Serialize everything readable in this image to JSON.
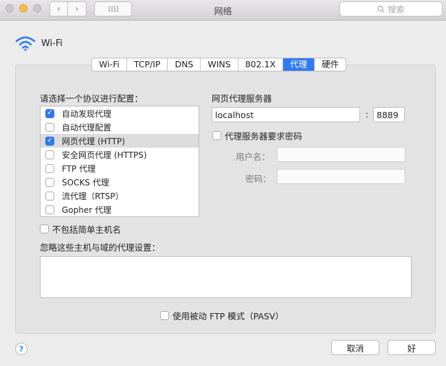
{
  "window": {
    "title": "网络",
    "search_placeholder": "搜索"
  },
  "header": {
    "service_name": "Wi-Fi"
  },
  "tabs": [
    {
      "label": "Wi-Fi",
      "active": false
    },
    {
      "label": "TCP/IP",
      "active": false
    },
    {
      "label": "DNS",
      "active": false
    },
    {
      "label": "WINS",
      "active": false
    },
    {
      "label": "802.1X",
      "active": false
    },
    {
      "label": "代理",
      "active": true
    },
    {
      "label": "硬件",
      "active": false
    }
  ],
  "protocols": {
    "heading": "请选择一个协议进行配置：",
    "items": [
      {
        "label": "自动发现代理",
        "checked": true,
        "selected": false
      },
      {
        "label": "自动代理配置",
        "checked": false,
        "selected": false
      },
      {
        "label": "网页代理 (HTTP)",
        "checked": true,
        "selected": true
      },
      {
        "label": "安全网页代理 (HTTPS)",
        "checked": false,
        "selected": false
      },
      {
        "label": "FTP 代理",
        "checked": false,
        "selected": false
      },
      {
        "label": "SOCKS 代理",
        "checked": false,
        "selected": false
      },
      {
        "label": "流代理（RTSP）",
        "checked": false,
        "selected": false
      },
      {
        "label": "Gopher 代理",
        "checked": false,
        "selected": false
      }
    ]
  },
  "proxy_server": {
    "heading": "网页代理服务器",
    "host": "localhost",
    "separator": ":",
    "port": "8889",
    "requires_password_label": "代理服务器要求密码",
    "requires_password": false,
    "username_label": "用户名：",
    "username": "",
    "password_label": "密码：",
    "password": ""
  },
  "exclude_simple_hostnames": {
    "label": "不包括简单主机名",
    "checked": false
  },
  "bypass": {
    "label": "忽略这些主机与域的代理设置：",
    "value": ""
  },
  "passive_ftp": {
    "label": "使用被动 FTP 模式（PASV）",
    "checked": false
  },
  "footer": {
    "help_label": "?",
    "cancel_label": "取消",
    "ok_label": "好"
  },
  "colors": {
    "accent": "#2f7af6",
    "panel": "#e3e3e3",
    "window": "#ececec"
  }
}
